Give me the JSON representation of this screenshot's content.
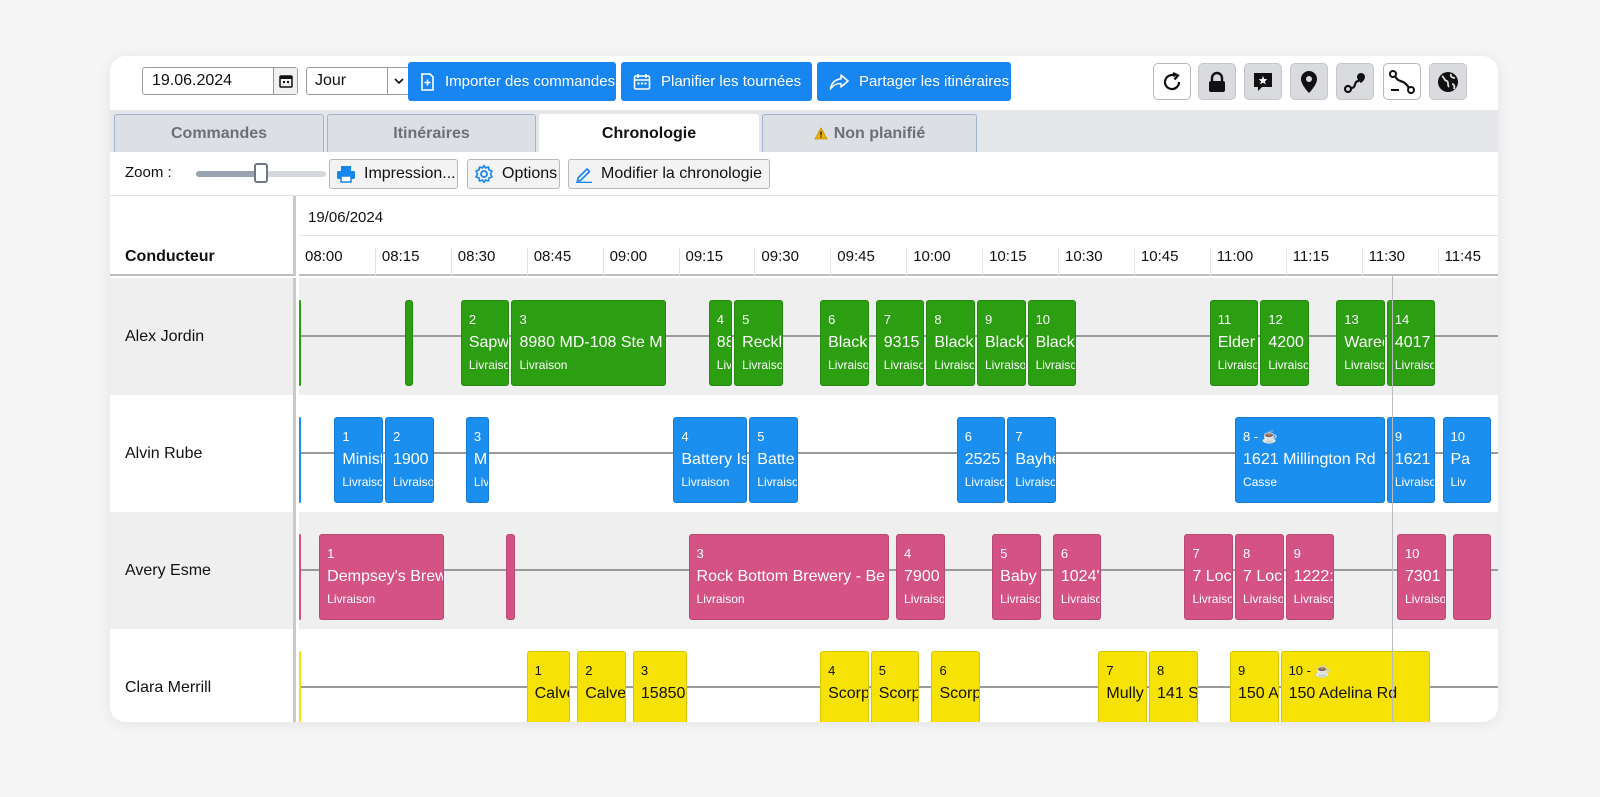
{
  "toolbar": {
    "date": "19.06.2024",
    "view": "Jour",
    "import_label": "Importer des commandes",
    "plan_label": "Planifier les tournées",
    "share_label": "Partager les itinéraires",
    "icons": [
      "refresh-icon",
      "lock-icon",
      "chat-star-icon",
      "map-pin-icon",
      "route-icon",
      "route-branch-icon",
      "globe-icon"
    ]
  },
  "tabs": [
    {
      "label": "Commandes",
      "active": false
    },
    {
      "label": "Itinéraires",
      "active": false
    },
    {
      "label": "Chronologie",
      "active": true
    },
    {
      "label": "Non planifié",
      "active": false,
      "warning": true
    }
  ],
  "subbar": {
    "zoom_label": "Zoom :",
    "zoom_level": 0.5,
    "print_label": "Impression...",
    "options_label": "Options",
    "edit_label": "Modifier la chronologie"
  },
  "timeline": {
    "date": "19/06/2024",
    "driver_header": "Conducteur",
    "hours": [
      "08:00",
      "08:15",
      "08:30",
      "08:45",
      "09:00",
      "09:15",
      "09:30",
      "09:45",
      "10:00",
      "10:15",
      "10:30",
      "10:45",
      "11:00",
      "11:15",
      "11:30",
      "11:45"
    ]
  },
  "colors": {
    "green": "#2b9e12",
    "blue": "#1b8ff0",
    "pink": "#d45384",
    "yellow": "#f6e305"
  },
  "drivers": [
    {
      "name": "Alex Jordin",
      "color": "green",
      "tasks": [
        {
          "start": "08:00",
          "end": "08:00",
          "num": "",
          "title": "",
          "sub": ""
        },
        {
          "start": "08:20",
          "end": "08:22",
          "num": "",
          "title": "",
          "sub": ""
        },
        {
          "start": "08:31",
          "end": "08:41",
          "num": "2",
          "title": "Sapwi",
          "sub": "Livraison"
        },
        {
          "start": "08:41",
          "end": "09:12",
          "num": "3",
          "title": "8980 MD-108 Ste M",
          "sub": "Livraison"
        },
        {
          "start": "09:20",
          "end": "09:25",
          "num": "4",
          "title": "88",
          "sub": "Liv"
        },
        {
          "start": "09:25",
          "end": "09:35",
          "num": "5",
          "title": "Reckl",
          "sub": "Livraison"
        },
        {
          "start": "09:42",
          "end": "09:52",
          "num": "6",
          "title": "Black",
          "sub": "Livraison"
        },
        {
          "start": "09:53",
          "end": "10:03",
          "num": "7",
          "title": "9315",
          "sub": "Livraison"
        },
        {
          "start": "10:03",
          "end": "10:13",
          "num": "8",
          "title": "Black",
          "sub": "Livraison"
        },
        {
          "start": "10:13",
          "end": "10:23",
          "num": "9",
          "title": "Black",
          "sub": "Livraison"
        },
        {
          "start": "10:23",
          "end": "10:33",
          "num": "10",
          "title": "Black",
          "sub": "Livraison"
        },
        {
          "start": "10:59",
          "end": "11:09",
          "num": "11",
          "title": "Elder",
          "sub": "Livraison"
        },
        {
          "start": "11:09",
          "end": "11:19",
          "num": "12",
          "title": "4200",
          "sub": "Livraison"
        },
        {
          "start": "11:24",
          "end": "11:34",
          "num": "13",
          "title": "Warec",
          "sub": "Livraison"
        },
        {
          "start": "11:34",
          "end": "11:44",
          "num": "14",
          "title": "4017",
          "sub": "Livraison"
        }
      ]
    },
    {
      "name": "Alvin Rube",
      "color": "blue",
      "tasks": [
        {
          "start": "08:00",
          "end": "08:00",
          "num": "",
          "title": "",
          "sub": ""
        },
        {
          "start": "08:06",
          "end": "08:16",
          "num": "1",
          "title": "Minist",
          "sub": "Livraison"
        },
        {
          "start": "08:16",
          "end": "08:26",
          "num": "2",
          "title": "1900",
          "sub": "Livraison"
        },
        {
          "start": "08:32",
          "end": "08:37",
          "num": "3",
          "title": "Mi",
          "sub": "Liv"
        },
        {
          "start": "09:13",
          "end": "09:28",
          "num": "4",
          "title": "Battery Is",
          "sub": "Livraison"
        },
        {
          "start": "09:28",
          "end": "09:38",
          "num": "5",
          "title": "Batte",
          "sub": "Livraison"
        },
        {
          "start": "10:09",
          "end": "10:19",
          "num": "6",
          "title": "2525",
          "sub": "Livraison"
        },
        {
          "start": "10:19",
          "end": "10:29",
          "num": "7",
          "title": "Bayhe",
          "sub": "Livraison"
        },
        {
          "start": "11:04",
          "end": "11:34",
          "num": "8 - ☕",
          "title": "1621 Millington Rd",
          "sub": "Casse"
        },
        {
          "start": "11:34",
          "end": "11:44",
          "num": "9",
          "title": "1621",
          "sub": "Livraison"
        },
        {
          "start": "11:45",
          "end": "11:55",
          "num": "10",
          "title": "Pa",
          "sub": "Liv"
        }
      ]
    },
    {
      "name": "Avery Esme",
      "color": "pink",
      "tasks": [
        {
          "start": "08:00",
          "end": "08:00",
          "num": "",
          "title": "",
          "sub": ""
        },
        {
          "start": "08:03",
          "end": "08:28",
          "num": "1",
          "title": "Dempsey's Brew",
          "sub": "Livraison"
        },
        {
          "start": "08:40",
          "end": "08:42",
          "num": "",
          "title": "",
          "sub": ""
        },
        {
          "start": "09:16",
          "end": "09:56",
          "num": "3",
          "title": "Rock Bottom Brewery - Be",
          "sub": "Livraison"
        },
        {
          "start": "09:57",
          "end": "10:07",
          "num": "4",
          "title": "7900",
          "sub": "Livraison"
        },
        {
          "start": "10:16",
          "end": "10:26",
          "num": "5",
          "title": "Baby",
          "sub": "Livraison"
        },
        {
          "start": "10:28",
          "end": "10:38",
          "num": "6",
          "title": "1024'",
          "sub": "Livraison"
        },
        {
          "start": "10:54",
          "end": "11:04",
          "num": "7",
          "title": "7 Loc",
          "sub": "Livraison"
        },
        {
          "start": "11:04",
          "end": "11:14",
          "num": "8",
          "title": "7 Loc",
          "sub": "Livraison"
        },
        {
          "start": "11:14",
          "end": "11:24",
          "num": "9",
          "title": "1222:",
          "sub": "Livraison"
        },
        {
          "start": "11:36",
          "end": "11:46",
          "num": "10",
          "title": "7301",
          "sub": "Livraison"
        },
        {
          "start": "11:47",
          "end": "11:55",
          "num": "",
          "title": "",
          "sub": ""
        }
      ]
    },
    {
      "name": "Clara Merrill",
      "color": "yellow",
      "tasks": [
        {
          "start": "08:00",
          "end": "08:00",
          "num": "",
          "title": "",
          "sub": ""
        },
        {
          "start": "08:44",
          "end": "08:53",
          "num": "1",
          "title": "Calve",
          "sub": ""
        },
        {
          "start": "08:54",
          "end": "09:04",
          "num": "2",
          "title": "Calve",
          "sub": ""
        },
        {
          "start": "09:05",
          "end": "09:16",
          "num": "3",
          "title": "15850",
          "sub": ""
        },
        {
          "start": "09:42",
          "end": "09:52",
          "num": "4",
          "title": "Scorp",
          "sub": ""
        },
        {
          "start": "09:52",
          "end": "10:02",
          "num": "5",
          "title": "Scorp",
          "sub": ""
        },
        {
          "start": "10:04",
          "end": "10:14",
          "num": "6",
          "title": "Scorp",
          "sub": ""
        },
        {
          "start": "10:37",
          "end": "10:47",
          "num": "7",
          "title": "Mully",
          "sub": ""
        },
        {
          "start": "10:47",
          "end": "10:57",
          "num": "8",
          "title": "141 S",
          "sub": ""
        },
        {
          "start": "11:03",
          "end": "11:13",
          "num": "9",
          "title": "150 A",
          "sub": ""
        },
        {
          "start": "11:13",
          "end": "11:43",
          "num": "10 - ☕",
          "title": "150 Adelina Rd",
          "sub": ""
        }
      ]
    }
  ]
}
